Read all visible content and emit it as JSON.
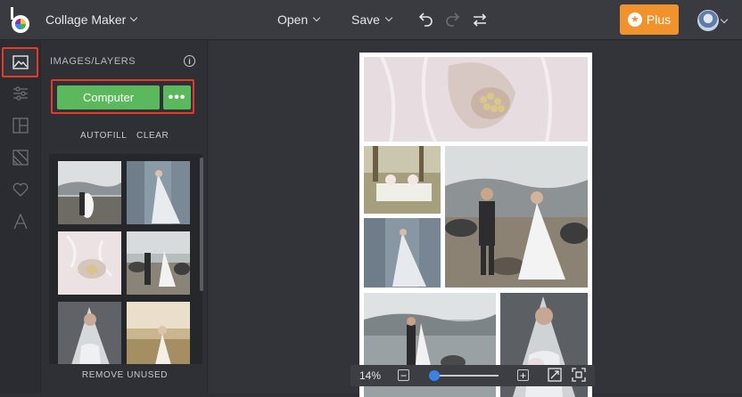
{
  "header": {
    "app_title": "Collage Maker",
    "open_label": "Open",
    "save_label": "Save",
    "plus_label": "Plus",
    "brand_color": "#f0932d"
  },
  "sidebar": {
    "items": [
      {
        "icon": "image-icon",
        "active": true
      },
      {
        "icon": "sliders-icon"
      },
      {
        "icon": "layout-icon"
      },
      {
        "icon": "background-icon"
      },
      {
        "icon": "heart-icon"
      },
      {
        "icon": "text-icon"
      }
    ]
  },
  "panel": {
    "title": "IMAGES/LAYERS",
    "computer_button": "Computer",
    "more_button": "•••",
    "autofill": "AUTOFILL",
    "clear": "CLEAR",
    "remove_unused": "REMOVE UNUSED",
    "thumbnails": [
      "couple-by-lake",
      "bride-in-gown",
      "pearl-bouquet",
      "couple-on-beach",
      "bride-with-veil",
      "bride-in-field"
    ]
  },
  "zoom": {
    "level": "14%",
    "minus": "−",
    "plus": "+",
    "slider_fraction": 0.0
  },
  "colors": {
    "accent_green": "#5cb85c",
    "highlight_red": "#e23b2c",
    "slider_blue": "#3b82e6"
  }
}
